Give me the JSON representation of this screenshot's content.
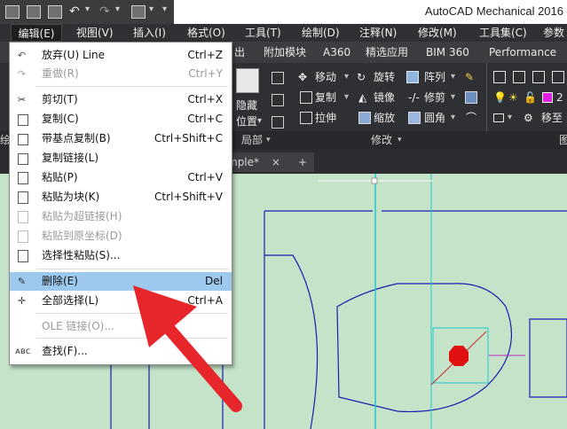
{
  "app": {
    "title": "AutoCAD Mechanical 2016"
  },
  "quick_access": {
    "icons": [
      "open-file-icon",
      "save-icon",
      "print-icon",
      "undo-icon",
      "redo-icon",
      "workspace-icon"
    ]
  },
  "menubar": {
    "items": [
      {
        "label": "编辑(E)",
        "open": true
      },
      {
        "label": "视图(V)"
      },
      {
        "label": "插入(I)"
      },
      {
        "label": "格式(O)"
      },
      {
        "label": "工具(T)"
      },
      {
        "label": "绘制(D)"
      },
      {
        "label": "注释(N)"
      },
      {
        "label": "修改(M)"
      },
      {
        "label": "工具集(C)"
      },
      {
        "label": "参数"
      }
    ]
  },
  "ribbon_tabs": [
    "出",
    "附加模块",
    "A360",
    "精选应用",
    "BIM 360",
    "Performance"
  ],
  "ribbon": {
    "large_buttons": {
      "hide_line1": "隐藏",
      "hide_line2": "位置"
    },
    "modify_tools": [
      "移动",
      "旋转",
      "阵列",
      "复制",
      "镜像",
      "修剪",
      "拉伸",
      "缩放",
      "圆角"
    ],
    "right_tools": [
      "移至"
    ],
    "layer_fragment": "2",
    "panel_titles": {
      "left_fragment": "绘",
      "local": "局部",
      "modify": "修改",
      "right_fragment": "图"
    }
  },
  "doc_tabs": {
    "active": "mple*",
    "close_symbol": "×",
    "new_symbol": "+"
  },
  "edit_menu": {
    "items": [
      {
        "label": "放弃(U) Line",
        "shortcut": "Ctrl+Z",
        "enabled": true,
        "icon": "undo-icon"
      },
      {
        "label": "重做(R)",
        "shortcut": "Ctrl+Y",
        "enabled": false,
        "icon": "redo-icon"
      },
      {
        "label": "剪切(T)",
        "shortcut": "Ctrl+X",
        "enabled": true,
        "icon": "scissors-icon"
      },
      {
        "label": "复制(C)",
        "shortcut": "Ctrl+C",
        "enabled": true,
        "icon": "copy-icon"
      },
      {
        "label": "带基点复制(B)",
        "shortcut": "Ctrl+Shift+C",
        "enabled": true,
        "icon": "copy-base-icon"
      },
      {
        "label": "复制链接(L)",
        "shortcut": "",
        "enabled": true,
        "icon": "copy-link-icon"
      },
      {
        "label": "粘贴(P)",
        "shortcut": "Ctrl+V",
        "enabled": true,
        "icon": "paste-icon"
      },
      {
        "label": "粘贴为块(K)",
        "shortcut": "Ctrl+Shift+V",
        "enabled": true,
        "icon": "paste-block-icon"
      },
      {
        "label": "粘贴为超链接(H)",
        "shortcut": "",
        "enabled": false,
        "icon": "paste-hyperlink-icon"
      },
      {
        "label": "粘贴到原坐标(D)",
        "shortcut": "",
        "enabled": false,
        "icon": "paste-original-icon"
      },
      {
        "label": "选择性粘贴(S)...",
        "shortcut": "",
        "enabled": true,
        "icon": "paste-special-icon"
      },
      {
        "label": "删除(E)",
        "shortcut": "Del",
        "enabled": true,
        "icon": "erase-icon",
        "highlighted": true
      },
      {
        "label": "全部选择(L)",
        "shortcut": "Ctrl+A",
        "enabled": true,
        "icon": "select-all-icon"
      },
      {
        "label": "OLE 链接(O)...",
        "shortcut": "",
        "enabled": false,
        "icon": ""
      },
      {
        "label": "查找(F)...",
        "shortcut": "",
        "enabled": true,
        "icon": "find-icon"
      }
    ]
  },
  "colors": {
    "canvas": "#c4e3c8",
    "drawing_line": "#1b1fb0",
    "center_line": "#22c7cf",
    "point_marker": "#e01010",
    "highlight": "#9ec9ef",
    "arrow": "#e6262a"
  }
}
